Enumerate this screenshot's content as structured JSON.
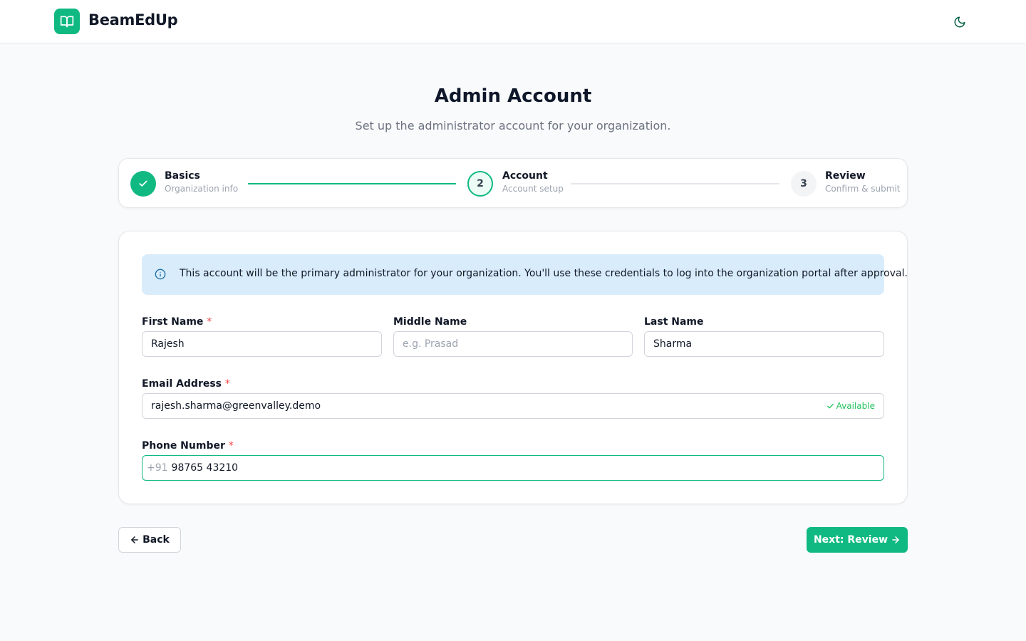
{
  "header": {
    "brand": "BeamEdUp",
    "logo_icon": "book-open-icon",
    "theme_icon": "moon-icon"
  },
  "page": {
    "title": "Admin Account",
    "subtitle": "Set up the administrator account for your organization."
  },
  "stepper": {
    "steps": [
      {
        "number": "1",
        "title": "Basics",
        "subtitle": "Organization info",
        "status": "completed"
      },
      {
        "number": "2",
        "title": "Account",
        "subtitle": "Account setup",
        "status": "active"
      },
      {
        "number": "3",
        "title": "Review",
        "subtitle": "Confirm & submit",
        "status": "pending"
      }
    ]
  },
  "info": {
    "icon": "info-icon",
    "text": "This account will be the primary administrator for your organization. You'll use these credentials to log into the organization portal after approval."
  },
  "form": {
    "first_name": {
      "label": "First Name",
      "required_mark": "*",
      "value": "Rajesh",
      "placeholder": ""
    },
    "middle_name": {
      "label": "Middle Name",
      "value": "",
      "placeholder": "e.g. Prasad"
    },
    "last_name": {
      "label": "Last Name",
      "value": "Sharma",
      "placeholder": ""
    },
    "email": {
      "label": "Email Address",
      "required_mark": "*",
      "value": "rajesh.sharma@greenvalley.demo",
      "status": "Available"
    },
    "phone": {
      "label": "Phone Number",
      "required_mark": "*",
      "prefix": "+91",
      "value": "98765 43210"
    }
  },
  "actions": {
    "back_label": "Back",
    "next_label": "Next: Review"
  },
  "colors": {
    "accent": "#10b981",
    "info_bg": "#d8ecfb",
    "required": "#ef4444",
    "available": "#22c55e"
  }
}
